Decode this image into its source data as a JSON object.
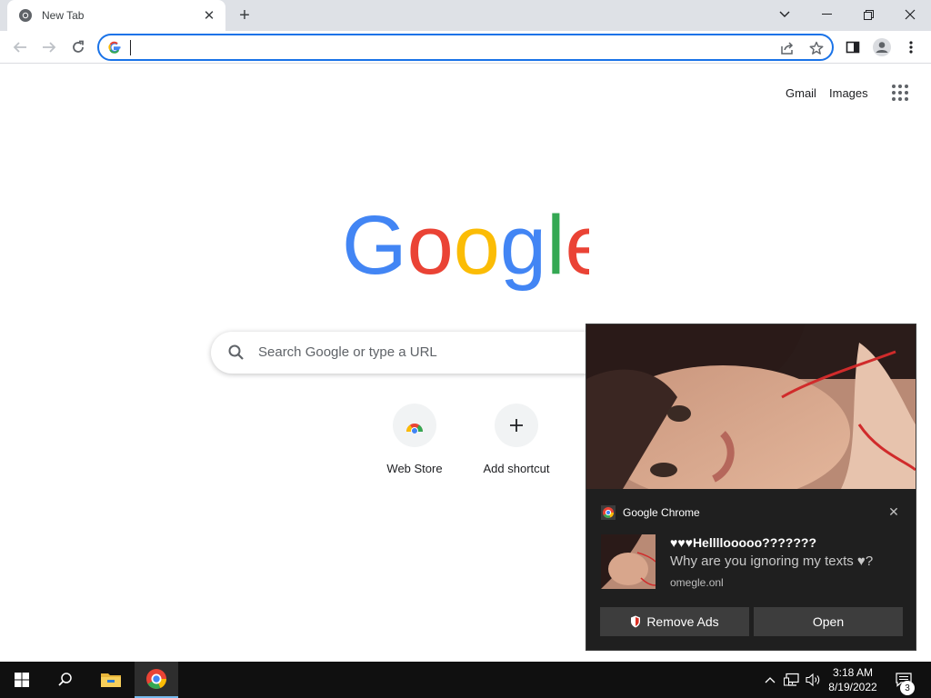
{
  "browser": {
    "tab": {
      "title": "New Tab"
    },
    "omnibox": {
      "value": "",
      "placeholder": ""
    }
  },
  "ntp": {
    "top_links": {
      "gmail": "Gmail",
      "images": "Images"
    },
    "search": {
      "placeholder": "Search Google or type a URL"
    },
    "shortcuts": [
      {
        "label": "Web Store",
        "icon": "web-store-icon"
      },
      {
        "label": "Add shortcut",
        "icon": "plus-icon"
      }
    ],
    "logo_colors": [
      "#4285F4",
      "#EA4335",
      "#FBBC05",
      "#34A853"
    ]
  },
  "notification": {
    "app_name": "Google Chrome",
    "title": "♥♥♥Hellllooooo???????",
    "body": "Why are you ignoring my texts ♥?",
    "source": "omegle.onl",
    "buttons": {
      "remove_ads": "Remove Ads",
      "open": "Open"
    }
  },
  "taskbar": {
    "time": "3:18 AM",
    "date": "8/19/2022",
    "notification_count": "3"
  },
  "colors": {
    "accent": "#1a73e8",
    "tabstrip": "#dee1e6",
    "toast_bg": "#1f1f1f",
    "taskbar_bg": "#101010"
  }
}
